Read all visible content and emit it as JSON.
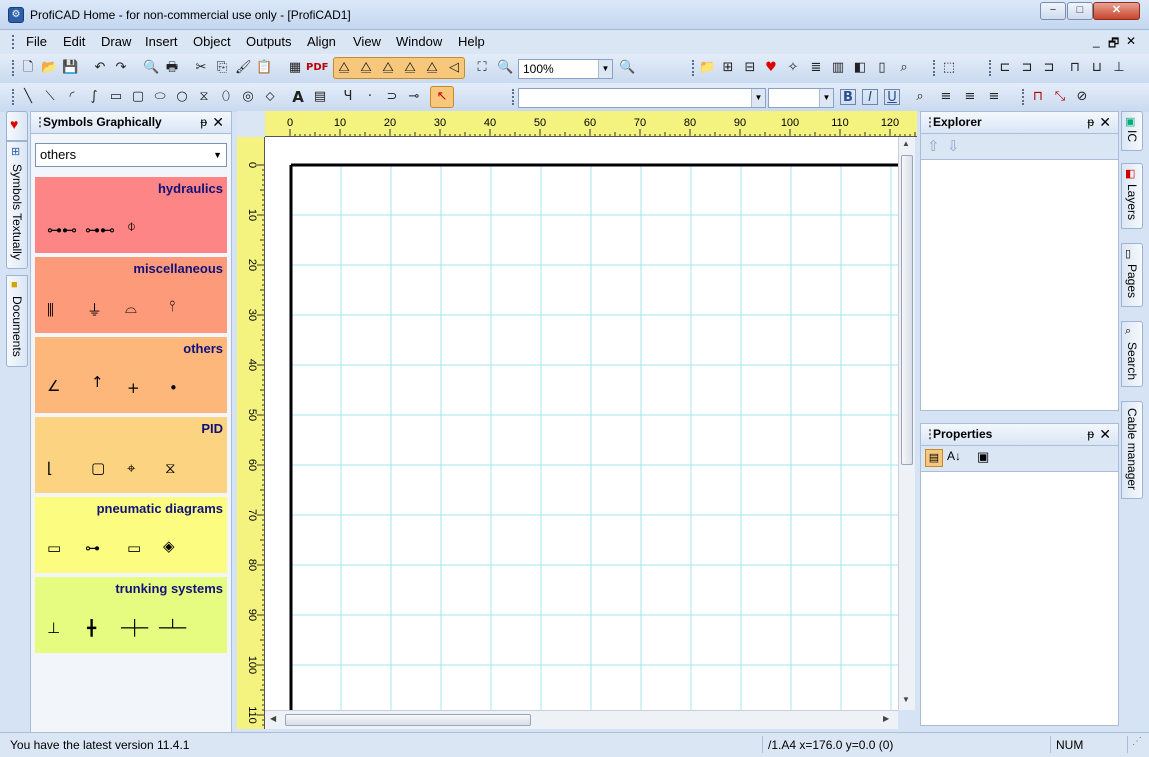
{
  "window": {
    "title": "ProfiCAD Home - for non-commercial use only - [ProfiCAD1]",
    "minimize": "−",
    "maximize": "□",
    "close": "✕"
  },
  "menu": [
    "File",
    "Edit",
    "Draw",
    "Insert",
    "Object",
    "Outputs",
    "Align",
    "View",
    "Window",
    "Help"
  ],
  "mdi_controls": [
    "_",
    "🗗",
    "✕"
  ],
  "toolbar": {
    "zoom_value": "100%",
    "font_name": "",
    "font_size": "",
    "bold": "B",
    "italic": "I",
    "underline": "U"
  },
  "left_tabs": [
    "Symbols Textually",
    "Documents"
  ],
  "symbols_panel": {
    "title": "Symbols Graphically",
    "pin": "ᵽ",
    "close": "✕",
    "category_dropdown": "others",
    "categories": [
      {
        "label": "hydraulics",
        "color": "#fd8585",
        "symbols": [
          "⊶⊷",
          "⊶⊷",
          "⌽"
        ]
      },
      {
        "label": "miscellaneous",
        "color": "#fd9a7a",
        "symbols": [
          "⫼",
          "⏚",
          "⌓",
          "⫯"
        ]
      },
      {
        "label": "others",
        "color": "#fdb77a",
        "symbols": [
          "∠",
          "↑",
          "+",
          "•"
        ]
      },
      {
        "label": "PID",
        "color": "#fcd380",
        "symbols": [
          "⌊",
          "▢",
          "⌖",
          "⧖"
        ]
      },
      {
        "label": "pneumatic diagrams",
        "color": "#fcfc80",
        "symbols": [
          "▭",
          "⊶",
          "▭",
          "◈"
        ]
      },
      {
        "label": "trunking systems",
        "color": "#e6fc80",
        "symbols": [
          "⊥",
          "╋",
          "─┼─",
          "─┴─"
        ]
      }
    ]
  },
  "ruler": {
    "top_labels": [
      "0",
      "10",
      "20",
      "30",
      "40",
      "50",
      "60",
      "70",
      "80",
      "90",
      "100",
      "110",
      "120"
    ],
    "left_labels": [
      "0",
      "10",
      "20",
      "30",
      "40",
      "50",
      "60",
      "70",
      "80",
      "90",
      "100",
      "110"
    ]
  },
  "explorer": {
    "title": "Explorer",
    "pin": "ᵽ",
    "close": "✕"
  },
  "properties": {
    "title": "Properties",
    "pin": "ᵽ",
    "close": "✕"
  },
  "right_tabs": [
    "IC",
    "Layers",
    "Pages",
    "Search",
    "Cable manager"
  ],
  "status": {
    "message": "You have the latest version 11.4.1",
    "position": "/1.A4  x=176.0  y=0.0 (0)",
    "num": "NUM"
  },
  "colors": {
    "ruler": "#f4f380",
    "grid": "#9fe7ee",
    "accent": "#2c5fa8"
  }
}
